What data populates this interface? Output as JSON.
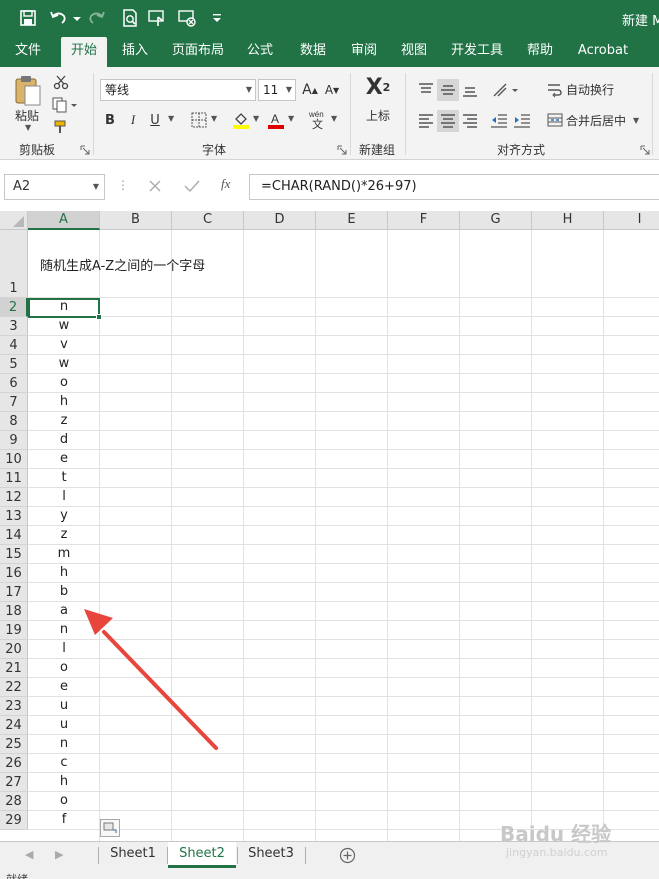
{
  "title_bar": {
    "doc_title": "新建 M"
  },
  "quick_access": [
    {
      "name": "save-icon"
    },
    {
      "name": "undo-icon"
    },
    {
      "name": "redo-icon"
    },
    {
      "name": "print-preview-icon"
    },
    {
      "name": "touch-mode-icon"
    },
    {
      "name": "clear-format-icon"
    },
    {
      "name": "customize-qat-icon"
    }
  ],
  "tabs": [
    "文件",
    "开始",
    "插入",
    "页面布局",
    "公式",
    "数据",
    "审阅",
    "视图",
    "开发工具",
    "帮助",
    "Acrobat"
  ],
  "ribbon": {
    "clipboard": {
      "paste_label": "粘贴",
      "group_label": "剪贴板"
    },
    "font": {
      "font_name": "等线",
      "font_size": "11",
      "group_label": "字体",
      "bold": "B",
      "italic": "I",
      "underline": "U"
    },
    "new_group": {
      "button_label": "上标",
      "group_label": "新建组"
    },
    "alignment": {
      "wrap_text": "自动换行",
      "merge_center": "合并后居中",
      "group_label": "对齐方式"
    }
  },
  "formula_bar": {
    "name_box": "A2",
    "formula": "=CHAR(RAND()*26+97)",
    "fx": "fx"
  },
  "columns": [
    "A",
    "B",
    "C",
    "D",
    "E",
    "F",
    "G",
    "H",
    "I"
  ],
  "rows": [
    "1",
    "2",
    "3",
    "4",
    "5",
    "6",
    "7",
    "8",
    "9",
    "10",
    "11",
    "12",
    "13",
    "14",
    "15",
    "16",
    "17",
    "18",
    "19",
    "20",
    "21",
    "22",
    "23",
    "24",
    "25",
    "26",
    "27",
    "28",
    "29"
  ],
  "cells": {
    "A1": "随机生成A-Z之间的一个字母",
    "A_values": [
      "n",
      "w",
      "v",
      "w",
      "o",
      "h",
      "z",
      "d",
      "e",
      "t",
      "l",
      "y",
      "z",
      "m",
      "h",
      "b",
      "a",
      "n",
      "l",
      "o",
      "e",
      "u",
      "u",
      "n",
      "c",
      "h",
      "o",
      "f"
    ]
  },
  "sheets": {
    "tabs": [
      "Sheet1",
      "Sheet2",
      "Sheet3"
    ],
    "active": "Sheet2"
  },
  "status": {
    "text": "就绪"
  },
  "watermark": {
    "text": "Baidu 经验",
    "url": "jingyan.baidu.com"
  },
  "colors": {
    "accent": "#217346",
    "annotation": "#e8453c"
  }
}
